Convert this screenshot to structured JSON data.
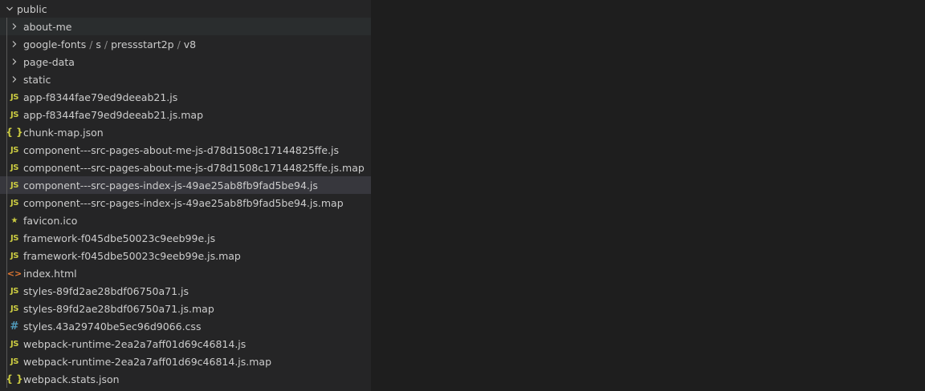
{
  "explorer": {
    "root": {
      "label": "public"
    },
    "folders": [
      {
        "label": "about-me"
      },
      {
        "parts": [
          "google-fonts",
          "s",
          "pressstart2p",
          "v8"
        ],
        "separator": " / "
      },
      {
        "label": "page-data"
      },
      {
        "label": "static"
      }
    ],
    "files": [
      {
        "label": "app-f8344fae79ed9deeab21.js",
        "icon": "js-icon",
        "glyph": "JS"
      },
      {
        "label": "app-f8344fae79ed9deeab21.js.map",
        "icon": "js-icon",
        "glyph": "JS"
      },
      {
        "label": "chunk-map.json",
        "icon": "json-icon",
        "glyph": "{ }"
      },
      {
        "label": "component---src-pages-about-me-js-d78d1508c17144825ffe.js",
        "icon": "js-icon",
        "glyph": "JS"
      },
      {
        "label": "component---src-pages-about-me-js-d78d1508c17144825ffe.js.map",
        "icon": "js-icon",
        "glyph": "JS"
      },
      {
        "label": "component---src-pages-index-js-49ae25ab8fb9fad5be94.js",
        "icon": "js-icon",
        "glyph": "JS"
      },
      {
        "label": "component---src-pages-index-js-49ae25ab8fb9fad5be94.js.map",
        "icon": "js-icon",
        "glyph": "JS"
      },
      {
        "label": "favicon.ico",
        "icon": "star-icon",
        "glyph": "★"
      },
      {
        "label": "framework-f045dbe50023c9eeb99e.js",
        "icon": "js-icon",
        "glyph": "JS"
      },
      {
        "label": "framework-f045dbe50023c9eeb99e.js.map",
        "icon": "js-icon",
        "glyph": "JS"
      },
      {
        "label": "index.html",
        "icon": "html-icon",
        "glyph": "<>"
      },
      {
        "label": "styles-89fd2ae28bdf06750a71.js",
        "icon": "js-icon",
        "glyph": "JS"
      },
      {
        "label": "styles-89fd2ae28bdf06750a71.js.map",
        "icon": "js-icon",
        "glyph": "JS"
      },
      {
        "label": "styles.43a29740be5ec96d9066.css",
        "icon": "css-icon",
        "glyph": "#"
      },
      {
        "label": "webpack-runtime-2ea2a7aff01d69c46814.js",
        "icon": "js-icon",
        "glyph": "JS"
      },
      {
        "label": "webpack-runtime-2ea2a7aff01d69c46814.js.map",
        "icon": "js-icon",
        "glyph": "JS"
      },
      {
        "label": "webpack.stats.json",
        "icon": "json-icon",
        "glyph": "{ }"
      }
    ]
  },
  "colors": {
    "sidebar_bg": "#252526",
    "editor_bg": "#1e1e1e",
    "selected_row_bg": "#37373d",
    "hover_row_bg": "#2a2d2e",
    "text": "#cccccc",
    "js_icon": "#cbcb41",
    "json_icon": "#cbcb41",
    "html_icon": "#e37933",
    "css_icon": "#519aba"
  }
}
